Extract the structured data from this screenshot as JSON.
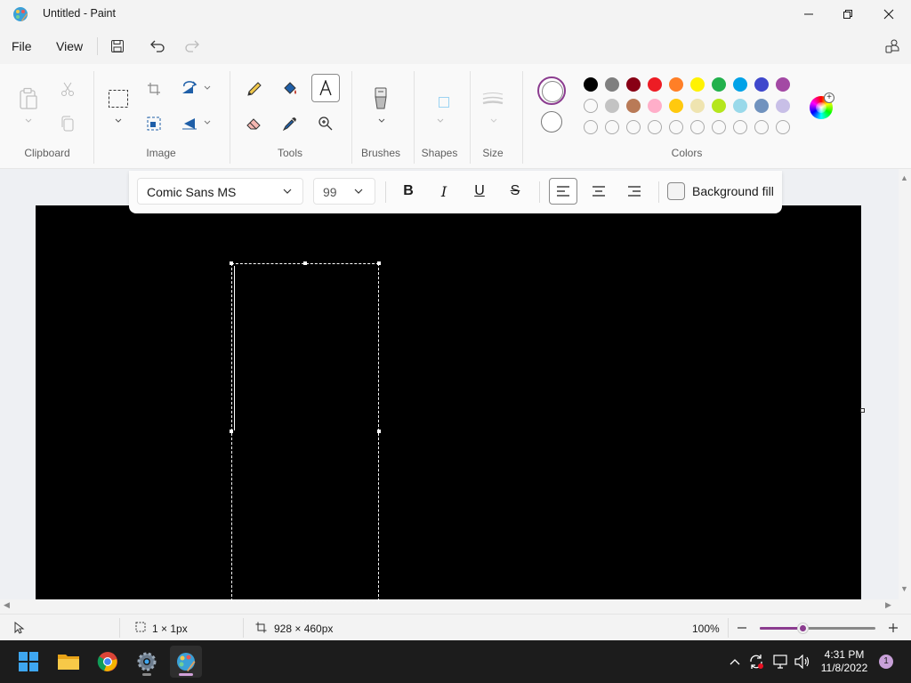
{
  "window": {
    "title": "Untitled - Paint"
  },
  "menu": {
    "file": "File",
    "view": "View"
  },
  "ribbon": {
    "groups": {
      "clipboard": "Clipboard",
      "image": "Image",
      "tools": "Tools",
      "brushes": "Brushes",
      "shapes": "Shapes",
      "size": "Size",
      "colors": "Colors"
    },
    "active_tool": "text",
    "palette": {
      "row1": [
        "#000000",
        "#7f7f7f",
        "#880015",
        "#ed1c24",
        "#ff7f27",
        "#fff200",
        "#22b14c",
        "#00a2e8",
        "#3f48cc",
        "#a349a4"
      ],
      "row2": [
        "#ffffff",
        "#c3c3c3",
        "#b97a57",
        "#ffaec9",
        "#ffc90e",
        "#efe4b0",
        "#b5e61d",
        "#99d9ea",
        "#7092be",
        "#c8bfe7"
      ],
      "row3_empty_slots": 10
    },
    "primary_color": "#ffffff",
    "secondary_color": "#ffffff",
    "accent": "#8b3c8f"
  },
  "text_toolbar": {
    "font": "Comic Sans MS",
    "size": "99",
    "bold": "B",
    "italic": "I",
    "underline": "U",
    "strikethrough": "S",
    "align_active": "left",
    "background_fill_label": "Background fill",
    "background_fill_checked": false
  },
  "canvas": {
    "background": "#000000"
  },
  "status": {
    "selection": "1 × 1px",
    "canvas_size": "928 × 460px",
    "zoom": "100%",
    "zoom_level": 0.38
  },
  "taskbar": {
    "apps": [
      "start-icon",
      "file-explorer-icon",
      "chrome-icon",
      "settings-icon",
      "paint-icon"
    ],
    "time": "4:31 PM",
    "date": "11/8/2022",
    "notifications": "1"
  }
}
